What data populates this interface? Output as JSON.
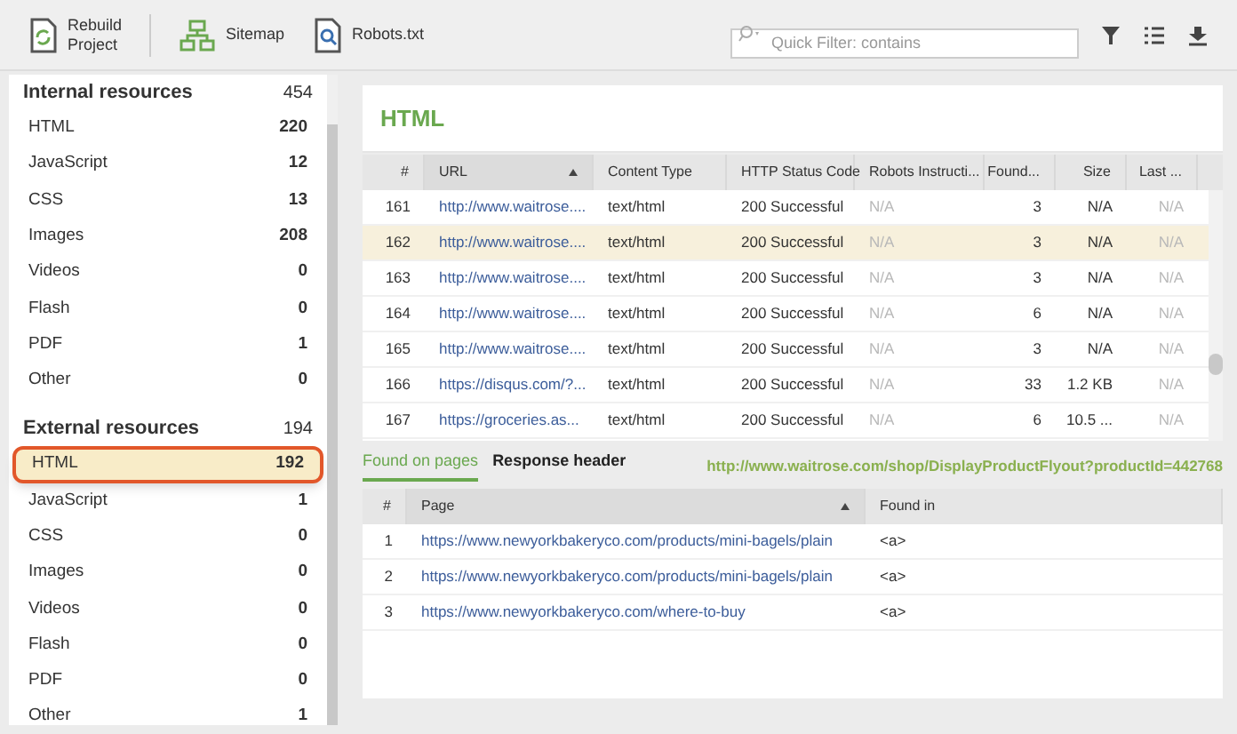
{
  "toolbar": {
    "buttons": [
      {
        "label": "Rebuild Project",
        "kind": "rebuild"
      },
      {
        "label": "Sitemap",
        "kind": "sitemap"
      },
      {
        "label": "Robots.txt",
        "kind": "robots"
      }
    ],
    "filter": {
      "placeholder": "Quick Filter: contains"
    }
  },
  "sidebar": {
    "groups": [
      {
        "title": "Internal resources",
        "count": "454",
        "items": [
          {
            "label": "HTML",
            "count": "220",
            "selected": false
          },
          {
            "label": "JavaScript",
            "count": "12",
            "selected": false
          },
          {
            "label": "CSS",
            "count": "13",
            "selected": false
          },
          {
            "label": "Images",
            "count": "208",
            "selected": false
          },
          {
            "label": "Videos",
            "count": "0",
            "selected": false
          },
          {
            "label": "Flash",
            "count": "0",
            "selected": false
          },
          {
            "label": "PDF",
            "count": "1",
            "selected": false
          },
          {
            "label": "Other",
            "count": "0",
            "selected": false
          }
        ]
      },
      {
        "title": "External resources",
        "count": "194",
        "items": [
          {
            "label": "HTML",
            "count": "192",
            "selected": true
          },
          {
            "label": "JavaScript",
            "count": "1",
            "selected": false
          },
          {
            "label": "CSS",
            "count": "0",
            "selected": false
          },
          {
            "label": "Images",
            "count": "0",
            "selected": false
          },
          {
            "label": "Videos",
            "count": "0",
            "selected": false
          },
          {
            "label": "Flash",
            "count": "0",
            "selected": false
          },
          {
            "label": "PDF",
            "count": "0",
            "selected": false
          },
          {
            "label": "Other",
            "count": "1",
            "selected": false
          }
        ]
      }
    ]
  },
  "panel": {
    "title": "HTML"
  },
  "table": {
    "columns": [
      "#",
      "URL",
      "Content Type",
      "HTTP Status Code",
      "Robots Instructi...",
      "Found...",
      "Size",
      "Last ..."
    ],
    "rows": [
      {
        "cells": [
          "161",
          "http://www.waitrose....",
          "text/html",
          "200 Successful",
          "N/A",
          "3",
          "N/A",
          "N/A"
        ],
        "selected": false
      },
      {
        "cells": [
          "162",
          "http://www.waitrose....",
          "text/html",
          "200 Successful",
          "N/A",
          "3",
          "N/A",
          "N/A"
        ],
        "selected": true
      },
      {
        "cells": [
          "163",
          "http://www.waitrose....",
          "text/html",
          "200 Successful",
          "N/A",
          "3",
          "N/A",
          "N/A"
        ],
        "selected": false
      },
      {
        "cells": [
          "164",
          "http://www.waitrose....",
          "text/html",
          "200 Successful",
          "N/A",
          "6",
          "N/A",
          "N/A"
        ],
        "selected": false
      },
      {
        "cells": [
          "165",
          "http://www.waitrose....",
          "text/html",
          "200 Successful",
          "N/A",
          "3",
          "N/A",
          "N/A"
        ],
        "selected": false
      },
      {
        "cells": [
          "166",
          "https://disqus.com/?...",
          "text/html",
          "200 Successful",
          "N/A",
          "33",
          "1.2 KB",
          "N/A"
        ],
        "selected": false
      },
      {
        "cells": [
          "167",
          "https://groceries.as...",
          "text/html",
          "200 Successful",
          "N/A",
          "6",
          "10.5 ...",
          "N/A"
        ],
        "selected": false
      }
    ]
  },
  "details": {
    "tabs": [
      {
        "label": "Found on pages",
        "selected": true
      },
      {
        "label": "Response header",
        "selected": false
      }
    ],
    "url": "http://www.waitrose.com/shop/DisplayProductFlyout?productId=442768",
    "columns": [
      "#",
      "Page",
      "Found in"
    ],
    "rows": [
      {
        "cells": [
          "1",
          "https://www.newyorkbakeryco.com/products/mini-bagels/plain",
          "<a>"
        ]
      },
      {
        "cells": [
          "2",
          "https://www.newyorkbakeryco.com/products/mini-bagels/plain",
          "<a>"
        ]
      },
      {
        "cells": [
          "3",
          "https://www.newyorkbakeryco.com/where-to-buy",
          "<a>"
        ]
      }
    ]
  }
}
